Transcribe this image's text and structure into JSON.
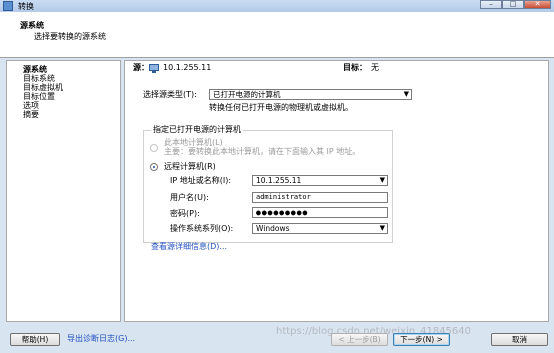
{
  "window": {
    "title": "转换",
    "controls": {
      "minimize": "–",
      "maximize": "□",
      "close": "✕"
    }
  },
  "header": {
    "title": "源系统",
    "subtitle": "选择要转换的源系统"
  },
  "sidebar": {
    "items": [
      {
        "label": "源系统",
        "active": true
      },
      {
        "label": "目标系统",
        "active": false
      },
      {
        "label": "目标虚拟机",
        "active": false
      },
      {
        "label": "目标位置",
        "active": false
      },
      {
        "label": "选项",
        "active": false
      },
      {
        "label": "摘要",
        "active": false
      }
    ]
  },
  "main": {
    "source_label": "源：",
    "source_value": "10.1.255.11",
    "target_label": "目标：",
    "target_value": "无",
    "source_type_label": "选择源类型(T):",
    "source_type_value": "已打开电源的计算机",
    "source_type_hint": "转换任何已打开电源的物理机或虚拟机。",
    "group_title": "指定已打开电源的计算机",
    "local_machine_label": "此本地计算机(L)",
    "local_machine_note": "主要：要转换此本地计算机，请在下面输入其 IP 地址。",
    "remote_machine_label": "远程计算机(R)",
    "ip_label": "IP 地址或名称(I):",
    "ip_value": "10.1.255.11",
    "username_label": "用户名(U):",
    "username_value": "administrator",
    "password_label": "密码(P):",
    "password_value": "●●●●●●●●●",
    "os_label": "操作系统系列(O):",
    "os_value": "Windows",
    "details_link": "查看源详细信息(D)..."
  },
  "footer": {
    "help_label": "帮助(H)",
    "export_log_label": "导出诊断日志(G)...",
    "back_label": "< 上一步(B)",
    "next_label": "下一步(N) >",
    "cancel_label": "取消"
  },
  "watermark": "https://blog.csdn.net/weixin_41845640",
  "colors": {
    "accent": "#2050c0",
    "title_bar": "#c9dcf2",
    "frame": "#d9e4f1"
  }
}
